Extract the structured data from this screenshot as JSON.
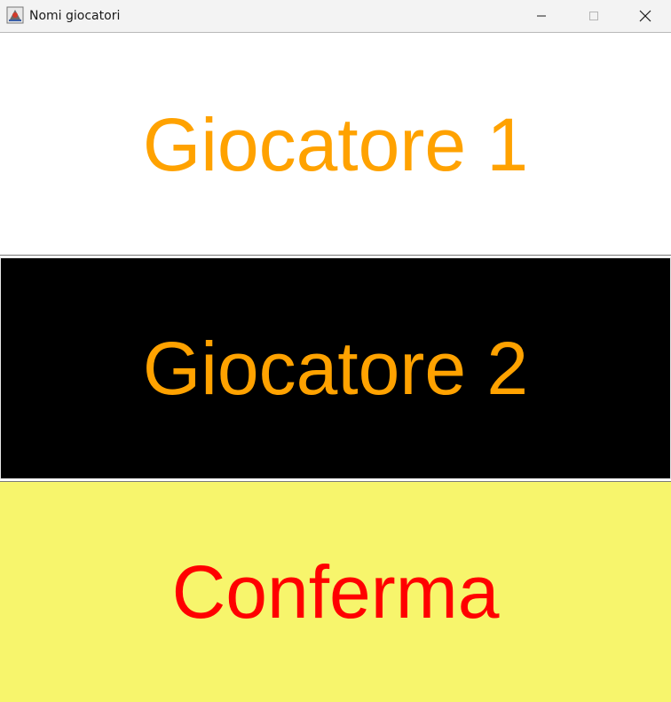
{
  "window": {
    "title": "Nomi giocatori",
    "icon": "java-app-icon",
    "controls": [
      "minimize",
      "maximize",
      "close"
    ]
  },
  "fields": [
    {
      "label": "Giocatore 1",
      "text_color": "#ffa200",
      "background": "#ffffff"
    },
    {
      "label": "Giocatore 2",
      "text_color": "#ffa200",
      "background": "#000000"
    }
  ],
  "confirm_button": {
    "label": "Conferma",
    "text_color": "#ff0000",
    "background": "#f7f56c"
  }
}
